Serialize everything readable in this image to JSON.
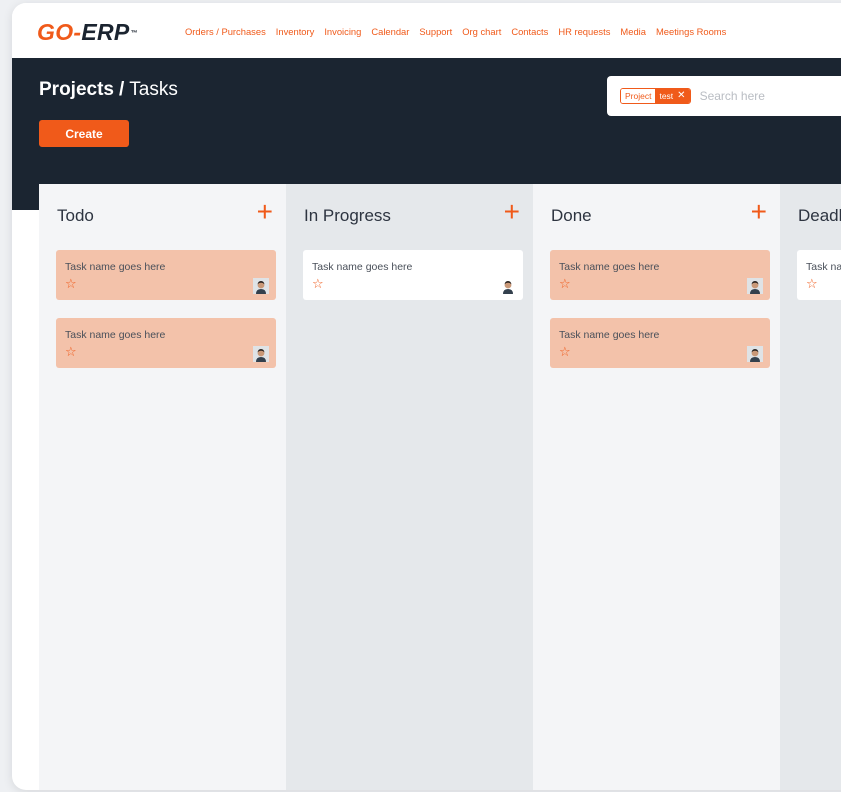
{
  "brand": {
    "logo_go": "GO",
    "logo_dash": "-",
    "logo_erp": "ERP",
    "logo_tm": "™",
    "accent": "#f05a1a",
    "dark": "#1b2531"
  },
  "nav": {
    "items": [
      {
        "label": "Orders / Purchases"
      },
      {
        "label": "Inventory"
      },
      {
        "label": "Invoicing"
      },
      {
        "label": "Calendar"
      },
      {
        "label": "Support"
      },
      {
        "label": "Org chart"
      },
      {
        "label": "Contacts"
      },
      {
        "label": "HR requests"
      },
      {
        "label": "Media"
      },
      {
        "label": "Meetings Rooms"
      }
    ]
  },
  "header": {
    "breadcrumb_parent": "Projects",
    "breadcrumb_separator": "/",
    "breadcrumb_current": "Tasks",
    "create_label": "Create"
  },
  "search": {
    "facet_label": "Project",
    "facet_value": "test",
    "facet_remove": "✕",
    "placeholder": "Search here"
  },
  "board": {
    "add_icon": "+",
    "columns": [
      {
        "title": "Todo",
        "cards": [
          {
            "title": "Task name goes here",
            "star": "☆"
          },
          {
            "title": "Task name goes here",
            "star": "☆"
          }
        ]
      },
      {
        "title": "In Progress",
        "cards": [
          {
            "title": "Task name goes here",
            "star": "☆"
          }
        ]
      },
      {
        "title": "Done",
        "cards": [
          {
            "title": "Task name goes here",
            "star": "☆"
          },
          {
            "title": "Task name goes here",
            "star": "☆"
          }
        ]
      },
      {
        "title": "Deadline",
        "cards": [
          {
            "title": "Task name goes here",
            "star": "☆"
          }
        ]
      }
    ]
  }
}
